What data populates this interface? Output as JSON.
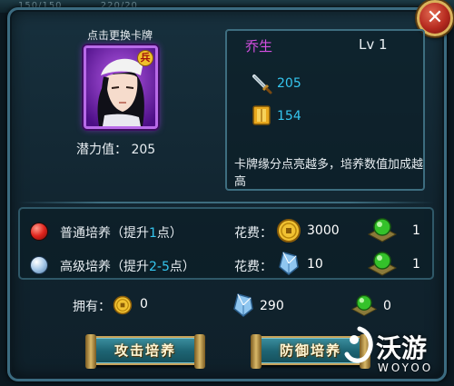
{
  "background": {
    "strip": [
      "150/150",
      "220/20"
    ]
  },
  "card": {
    "change_label": "点击更换卡牌",
    "potential_label": "潜力值：",
    "potential_value": "205",
    "badge": "兵"
  },
  "hero": {
    "name": "乔生",
    "level": "Lv 1",
    "attack": "205",
    "defense": "154",
    "description": "卡牌缘分点亮越多，培养数值加成越高"
  },
  "training": {
    "normal": {
      "label": "普通培养（提升",
      "amount": "1",
      "unit": "点）",
      "cost_label": "花费：",
      "cost": "3000",
      "gain": "1"
    },
    "advanced": {
      "label": "高级培养（提升",
      "amount": "2-5",
      "unit": "点）",
      "cost_label": "花费：",
      "cost": "10",
      "gain": "1"
    }
  },
  "owned": {
    "label": "拥有：",
    "coins": "0",
    "crystals": "290",
    "gems": "0"
  },
  "buttons": {
    "attack_train": "攻击培养",
    "defense_train": "防御培养"
  },
  "watermark": {
    "text": "沃游",
    "sub": "WOYOO"
  },
  "colors": {
    "panel_border": "#3b6b80",
    "hero_name": "#d34fe0",
    "stat_value": "#35c6ef",
    "highlight": "#35c6ef",
    "close_button": "#b52a1f"
  },
  "icons": {
    "attack": "sword-icon",
    "defense": "armor-icon",
    "coin": "gold-coin-icon",
    "crystal": "blue-crystal-icon",
    "gem": "green-gem-icon"
  }
}
